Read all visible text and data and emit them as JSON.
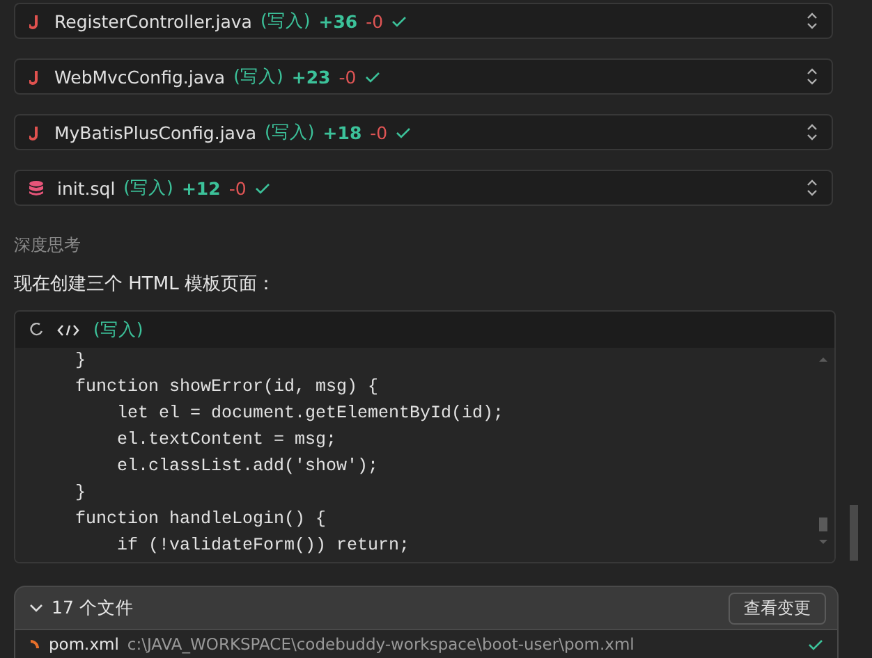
{
  "file_edits": [
    {
      "kind": "java",
      "name": "RegisterController.java",
      "mode": "(写入)",
      "added": "+36",
      "removed": "-0",
      "done": true
    },
    {
      "kind": "java",
      "name": "WebMvcConfig.java",
      "mode": "(写入)",
      "added": "+23",
      "removed": "-0",
      "done": true
    },
    {
      "kind": "java",
      "name": "MyBatisPlusConfig.java",
      "mode": "(写入)",
      "added": "+18",
      "removed": "-0",
      "done": true
    },
    {
      "kind": "database",
      "name": "init.sql",
      "mode": "(写入)",
      "added": "+12",
      "removed": "-0",
      "done": true
    }
  ],
  "thinking_label": "深度思考",
  "message": "现在创建三个 HTML 模板页面：",
  "code_block": {
    "loading": true,
    "mode": "(写入)",
    "lines": [
      "    }",
      "    function showError(id, msg) {",
      "        let el = document.getElementById(id);",
      "        el.textContent = msg;",
      "        el.classList.add('show');",
      "    }",
      "    function handleLogin() {",
      "        if (!validateForm()) return;"
    ]
  },
  "changes_panel": {
    "expanded": true,
    "title": "17 个文件",
    "button": "查看变更",
    "files": [
      {
        "name": "pom.xml",
        "path": "c:\\JAVA_WORKSPACE\\codebuddy-workspace\\boot-user\\pom.xml",
        "done": true
      }
    ]
  }
}
